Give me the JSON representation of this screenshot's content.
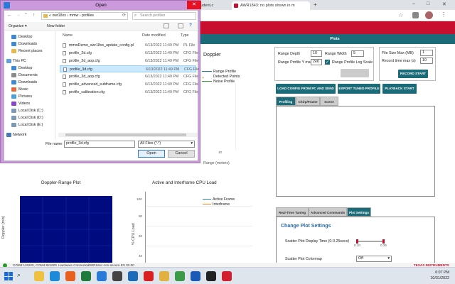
{
  "browser": {
    "tabs": [
      {
        "label": "student.c",
        "fav_color": "#e0501f"
      },
      {
        "label": "AWR1843: no plots shown in m",
        "fav_color": "#c8102e"
      }
    ],
    "new_tab": "+",
    "window_controls": [
      "–",
      "□",
      "✕"
    ]
  },
  "app": {
    "header_tab_plots": "Plots",
    "doppler_partial": "Doppler",
    "legend_top": [
      "Range Profile",
      "Detected Points",
      "Noise Profile"
    ],
    "range_axis_label": "Range (meters)",
    "range_axis_tick": "10",
    "settings": {
      "range_depth_label": "Range Depth",
      "range_depth_value": "10",
      "range_width_label": "Range Width",
      "range_width_value": "5",
      "range_profile_y_label": "Range Profile Y max",
      "range_profile_y_value": "2e6",
      "log_scale_label": "Range Profile Log Scale",
      "file_size_label": "File Size Max (MB)",
      "file_size_value": "1",
      "record_time_label": "Record time max (s)",
      "record_time_value": "10",
      "record_start": "RECORD START",
      "load_config": "LOAD CONFIG FROM PC AND SEND",
      "export_profile": "EXPORT TUNED PROFILE",
      "playback_start": "PLAYBACK START"
    },
    "profile_tabs": [
      "Profiling",
      "Chirp/Frame",
      "Scene"
    ],
    "bottom_tabs": [
      "Real-Time Tuning",
      "Advanced Commands",
      "Plot Settings"
    ],
    "change_plot_settings": "Change Plot Settings",
    "scatter_display_label": "Scatter Plot Display Time (0-0.25secs)",
    "scatter_min": "0.10",
    "scatter_max": "0.25",
    "scatter_colormap_label": "Scatter Plot Colormap",
    "scatter_colormap_value": "Off",
    "doppler_range_title": "Doppler-Range Plot",
    "doppler_axis_label": "Doppler (m/s)",
    "cpu_title": "Active and Interframe  CPU Load",
    "cpu_axis_label": "% CPU Load",
    "cpu_ticks": [
      "100",
      "80",
      "60",
      "40"
    ],
    "cpu_legend": [
      {
        "name": "Active Frame",
        "color": "#1f77b4"
      },
      {
        "name": "Interframe",
        "color": "#ff7f0e"
      }
    ],
    "status": [
      "COM4:115200, COM4:921600",
      "Hardware Connected",
      "AWR18xx non-secure ES 02.00"
    ],
    "ti_logo": "TEXAS INSTRUMENTS"
  },
  "dialog": {
    "title": "Open",
    "path": [
      "«",
      "xwr18xx",
      "›",
      "mmw",
      "›",
      "profiles"
    ],
    "search_placeholder": "Search profiles",
    "organize": "Organize ▾",
    "new_folder": "New folder",
    "columns": {
      "name": "Name",
      "date": "Date modified",
      "type": "Type"
    },
    "nav_items": [
      {
        "label": "Desktop",
        "color": "#3c8ad8",
        "indent": 1
      },
      {
        "label": "Downloads",
        "color": "#3c8ad8",
        "indent": 1
      },
      {
        "label": "Recent places",
        "color": "#e8b84a",
        "indent": 1
      },
      {
        "label": "This PC",
        "color": "#5ea0e0",
        "indent": 0
      },
      {
        "label": "Desktop",
        "color": "#3c8ad8",
        "indent": 1
      },
      {
        "label": "Documents",
        "color": "#8a8a8a",
        "indent": 1
      },
      {
        "label": "Downloads",
        "color": "#3c8ad8",
        "indent": 1
      },
      {
        "label": "Music",
        "color": "#e86a3a",
        "indent": 1
      },
      {
        "label": "Pictures",
        "color": "#4aa0d8",
        "indent": 1
      },
      {
        "label": "Videos",
        "color": "#8844cc",
        "indent": 1
      },
      {
        "label": "Local Disk (C:)",
        "color": "#7a9ab8",
        "indent": 1
      },
      {
        "label": "Local Disk (D:)",
        "color": "#7a9ab8",
        "indent": 1
      },
      {
        "label": "Local Disk (E:)",
        "color": "#7a9ab8",
        "indent": 1
      },
      {
        "label": "Network",
        "color": "#4a7ab8",
        "indent": 0
      }
    ],
    "files": [
      {
        "name": "mmwDemo_xwr18xx_update_config.pl",
        "date": "6/13/2022 11:49 PM",
        "type": "PL File",
        "selected": false
      },
      {
        "name": "profile_2d.cfg",
        "date": "6/13/2022 11:49 PM",
        "type": "CFG File",
        "selected": false
      },
      {
        "name": "profile_2d_aop.cfg",
        "date": "6/13/2022 11:49 PM",
        "type": "CFG File",
        "selected": false
      },
      {
        "name": "profile_3d.cfg",
        "date": "6/13/2022 11:49 PM",
        "type": "CFG File",
        "selected": true
      },
      {
        "name": "profile_3d_aop.cfg",
        "date": "6/13/2022 11:49 PM",
        "type": "CFG File",
        "selected": false
      },
      {
        "name": "profile_advanced_subframe.cfg",
        "date": "6/13/2022 11:49 PM",
        "type": "CFG File",
        "selected": false
      },
      {
        "name": "profile_calibration.cfg",
        "date": "6/13/2022 11:49 PM",
        "type": "CFG File",
        "selected": false
      }
    ],
    "file_name_label": "File name:",
    "file_name_value": "profile_3d.cfg",
    "file_type_value": "All Files (*.*)",
    "open_button": "Open",
    "cancel_button": "Cancel"
  },
  "taskbar": {
    "search_label": "Search",
    "apps": [
      {
        "name": "file-explorer",
        "color": "#f0c040"
      },
      {
        "name": "edge",
        "color": "#1c8ad8"
      },
      {
        "name": "firefox",
        "color": "#e86020"
      },
      {
        "name": "excel",
        "color": "#1f7a3c"
      },
      {
        "name": "store",
        "color": "#2a7ad8"
      },
      {
        "name": "camera",
        "color": "#444444"
      },
      {
        "name": "media",
        "color": "#1c6bb8"
      },
      {
        "name": "acrobat",
        "color": "#d82020"
      },
      {
        "name": "explorer",
        "color": "#e0b040"
      },
      {
        "name": "chrome",
        "color": "#3a9a4a"
      },
      {
        "name": "outlook",
        "color": "#1c5ab8"
      },
      {
        "name": "terminal",
        "color": "#222222"
      },
      {
        "name": "app-cube",
        "color": "#d02030"
      }
    ],
    "time": "6:07 PM",
    "date": "10/31/2022"
  }
}
